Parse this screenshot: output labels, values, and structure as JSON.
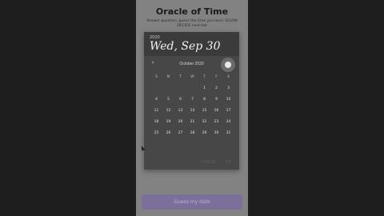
{
  "app": {
    "title": "Oracle of Time",
    "description": "Answer question, guess the time you learn SOLON DECIDE next tab"
  },
  "picker": {
    "year": "2020",
    "selected_date": "Wed, Sep 30",
    "month_label": "October 2020",
    "prev_icon": "chevron-left-icon",
    "next_icon": "circle-dot-icon",
    "weekdays": [
      "S",
      "M",
      "T",
      "W",
      "T",
      "F",
      "S"
    ],
    "weeks": [
      [
        "",
        "",
        "",
        "",
        "1",
        "2",
        "3"
      ],
      [
        "4",
        "5",
        "6",
        "7",
        "8",
        "9",
        "10"
      ],
      [
        "11",
        "12",
        "13",
        "14",
        "15",
        "16",
        "17"
      ],
      [
        "18",
        "19",
        "20",
        "21",
        "22",
        "23",
        "24"
      ],
      [
        "25",
        "26",
        "27",
        "28",
        "29",
        "30",
        "31"
      ]
    ],
    "cancel_label": "CANCEL",
    "ok_label": "OK"
  },
  "submit_label": "Guess my date",
  "colors": {
    "background": "#1e1e1e",
    "phone_bg": "#828282",
    "dialog_bg": "#474747",
    "accent": "#7d6f9c"
  }
}
